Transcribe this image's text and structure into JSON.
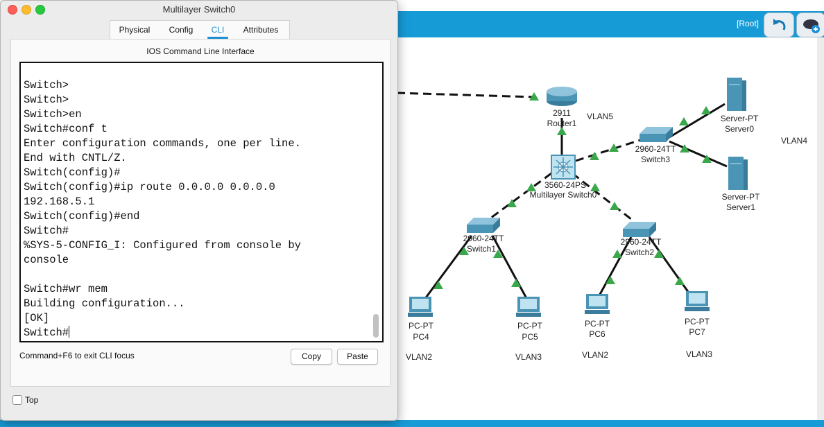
{
  "window": {
    "title": "Multilayer Switch0",
    "tabs": [
      {
        "label": "Physical",
        "active": false
      },
      {
        "label": "Config",
        "active": false
      },
      {
        "label": "CLI",
        "active": true
      },
      {
        "label": "Attributes",
        "active": false
      }
    ],
    "panel_heading": "IOS Command Line Interface",
    "cli_text": "Switch>\nSwitch>\nSwitch>en\nSwitch#conf t\nEnter configuration commands, one per line.\nEnd with CNTL/Z.\nSwitch(config)#\nSwitch(config)#ip route 0.0.0.0 0.0.0.0\n192.168.5.1\nSwitch(config)#end\nSwitch#\n%SYS-5-CONFIG_I: Configured from console by\nconsole\n\nSwitch#wr mem\nBuilding configuration...\n[OK]\nSwitch#",
    "hint": "Command+F6 to exit CLI focus",
    "copy_label": "Copy",
    "paste_label": "Paste",
    "top_label": "Top",
    "top_checked": false
  },
  "workspace": {
    "root_label": "[Root]",
    "devices": {
      "router1": {
        "model": "2911",
        "name": "Router1"
      },
      "mls0": {
        "model": "3560-24PS",
        "name": "Multilayer Switch0"
      },
      "switch3": {
        "model": "2960-24TT",
        "name": "Switch3"
      },
      "switch1": {
        "model": "2960-24TT",
        "name": "Switch1"
      },
      "switch2": {
        "model": "2960-24TT",
        "name": "Switch2"
      },
      "server0": {
        "model": "Server-PT",
        "name": "Server0"
      },
      "server1": {
        "model": "Server-PT",
        "name": "Server1"
      },
      "pc4": {
        "model": "PC-PT",
        "name": "PC4"
      },
      "pc5": {
        "model": "PC-PT",
        "name": "PC5"
      },
      "pc6": {
        "model": "PC-PT",
        "name": "PC6"
      },
      "pc7": {
        "model": "PC-PT",
        "name": "PC7"
      }
    },
    "vlan_labels": {
      "vlan5": "VLAN5",
      "vlan4": "VLAN4",
      "pc4_vlan": "VLAN2",
      "pc5_vlan": "VLAN3",
      "pc6_vlan": "VLAN2",
      "pc7_vlan": "VLAN3"
    },
    "colors": {
      "link_up": "#3aa84a",
      "device_body": "#4a94b5",
      "topbar": "#179bd7"
    }
  }
}
